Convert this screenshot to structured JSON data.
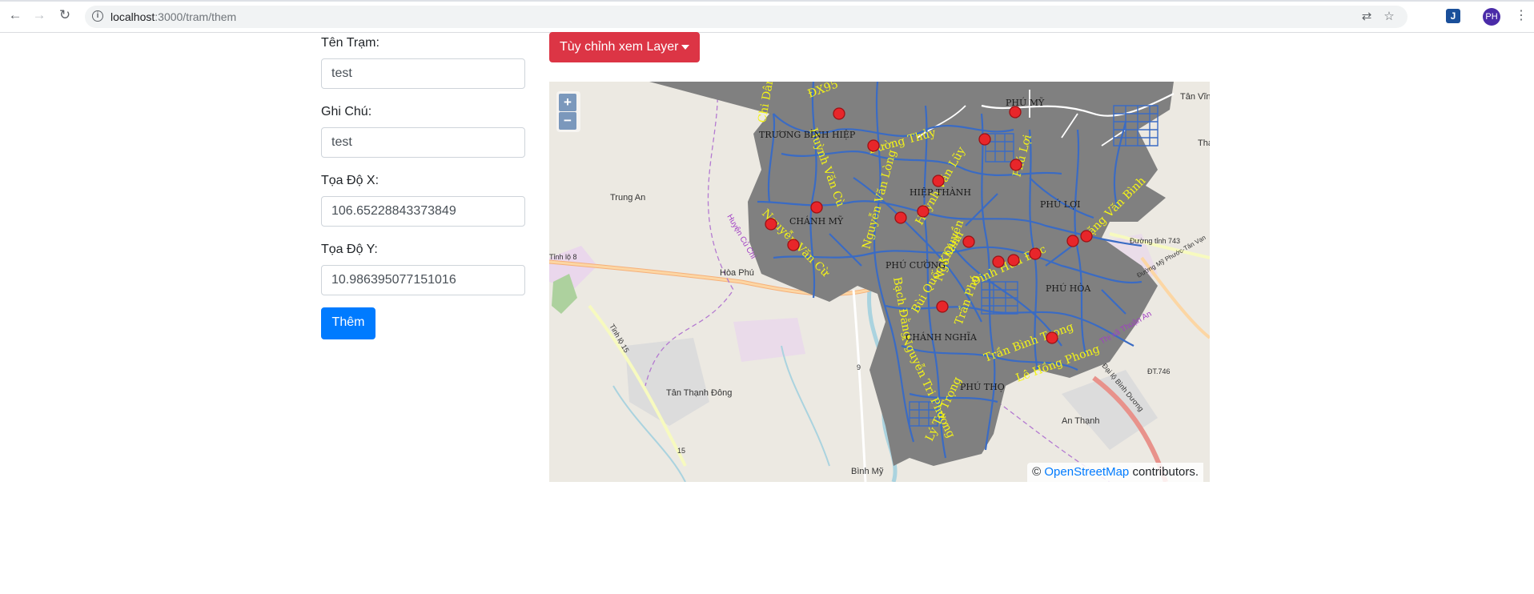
{
  "browser": {
    "url_host": "localhost",
    "url_rest": ":3000/tram/them",
    "avatar_initials": "PH",
    "extension_glyph": "J"
  },
  "form": {
    "station_name_label": "Tên Trạm:",
    "station_name_value": "test",
    "note_label": "Ghi Chú:",
    "note_value": "test",
    "coord_x_label": "Tọa Độ X:",
    "coord_x_value": "106.65228843373849",
    "coord_y_label": "Tọa Độ Y:",
    "coord_y_value": "10.986395077151016",
    "submit_label": "Thêm"
  },
  "layer_menu": {
    "label": "Tùy chỉnh xem Layer"
  },
  "map": {
    "zoom_in": "+",
    "zoom_out": "−",
    "attribution_prefix": "©",
    "attribution_link": "OpenStreetMap",
    "attribution_suffix": "contributors.",
    "area_labels": [
      "TRƯƠNG BÌNH HIỆP",
      "CHÁNH MỸ",
      "HIỆP THÀNH",
      "PHÚ LỢI",
      "PHÚ HÒA",
      "CHÁNH NGHĨA",
      "PHÚ THỌ",
      "PHÚ MỸ",
      "PHÚ CƯỜNG"
    ],
    "place_labels": [
      "Trung An",
      "Hòa Phú",
      "Tân Thạnh Đông",
      "An Thạnh",
      "Bình Mỹ",
      "Tân Vĩn",
      "Thạ"
    ],
    "road_labels": [
      "Tỉnh lộ 8",
      "Tỉnh lộ 15",
      "Đường tỉnh 743",
      "Đại lộ Bình Dương",
      "ĐT.746",
      "Đường Mỹ Phước-Tân Vạn",
      "Thị xã Thuận An",
      "Huyện Củ Chi",
      "9",
      "15"
    ],
    "colors": {
      "city_fill": "#808080",
      "road_network": "#3a6bc4",
      "station_marker": "#e8262a",
      "street_label": "#f5f516"
    }
  }
}
